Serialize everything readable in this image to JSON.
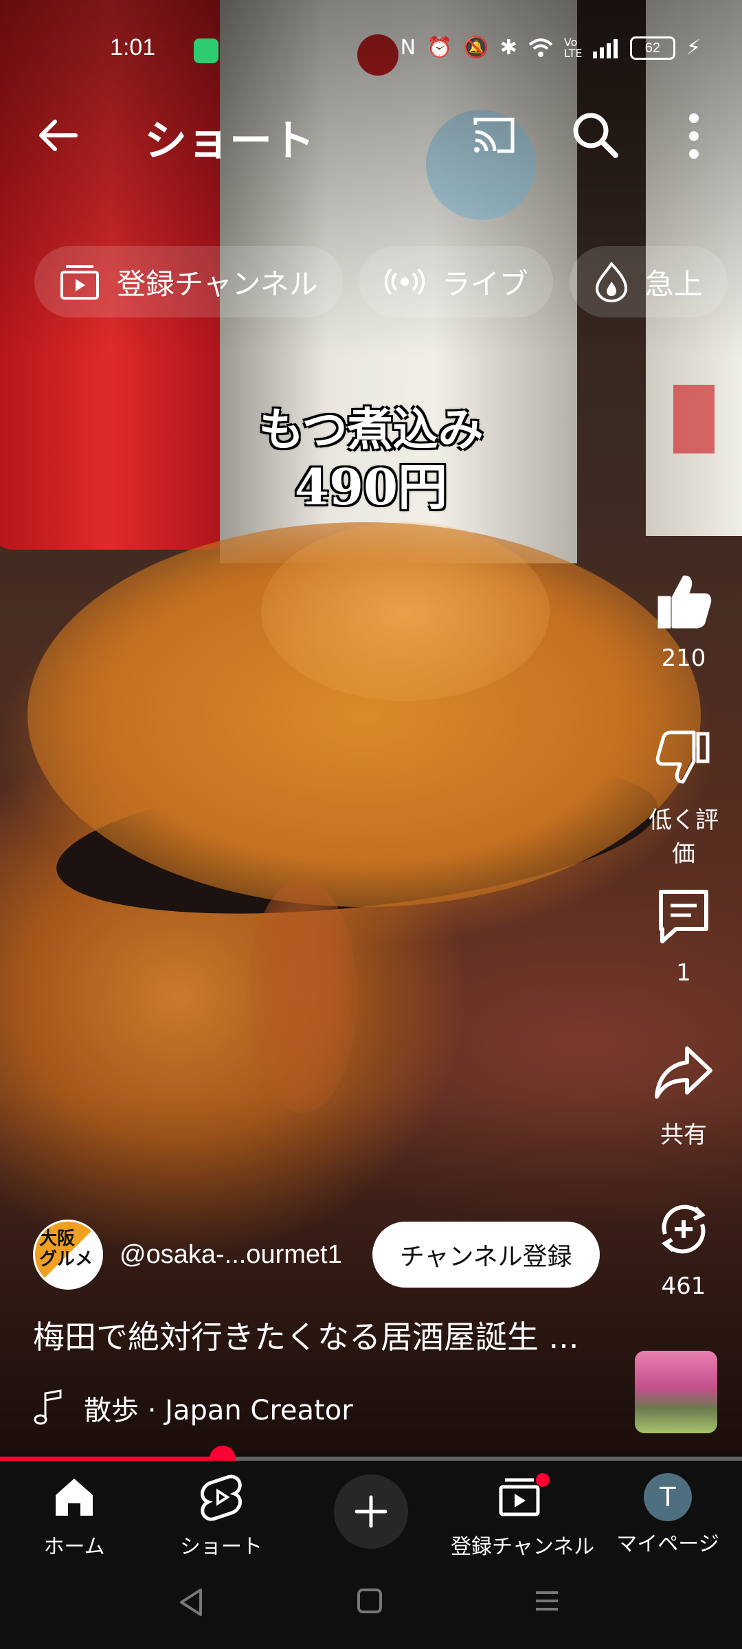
{
  "status_bar": {
    "time": "1:01",
    "icons": [
      "nfc-icon",
      "alarm-icon",
      "mute-icon",
      "bluetooth-icon",
      "wifi-icon",
      "volte-icon",
      "signal-icon",
      "battery-icon",
      "charging-icon"
    ],
    "volte_label": "Vo LTE",
    "battery_level": "62"
  },
  "header": {
    "title": "ショート",
    "back_icon": "arrow-left-icon",
    "cast_icon": "cast-icon",
    "search_icon": "search-icon",
    "more_icon": "more-vertical-icon"
  },
  "chips": [
    {
      "label": "登録チャンネル",
      "icon": "subscriptions-icon"
    },
    {
      "label": "ライブ",
      "icon": "live-icon"
    },
    {
      "label": "急上",
      "icon": "trending-icon"
    }
  ],
  "caption": {
    "line1": "もつ煮込み",
    "line2": "490円"
  },
  "actions": {
    "like_count": "210",
    "dislike_label": "低く評価",
    "comment_count": "1",
    "share_label": "共有",
    "remix_count": "461"
  },
  "channel": {
    "avatar_text_line1": "大阪",
    "avatar_text_line2": "グルメ",
    "handle": "@osaka-...ourmet1",
    "subscribe_label": "チャンネル登録"
  },
  "video": {
    "title": "梅田で絶対行きたくなる居酒屋誕生 ...",
    "music": "散歩 · Japan Creator",
    "progress": 0.3
  },
  "bottom_nav": {
    "home": "ホーム",
    "shorts": "ショート",
    "subscriptions": "登録チャンネル",
    "me": "マイページ",
    "me_initial": "T"
  },
  "colors": {
    "accent": "#ff0033",
    "background": "#0f0f0f"
  }
}
